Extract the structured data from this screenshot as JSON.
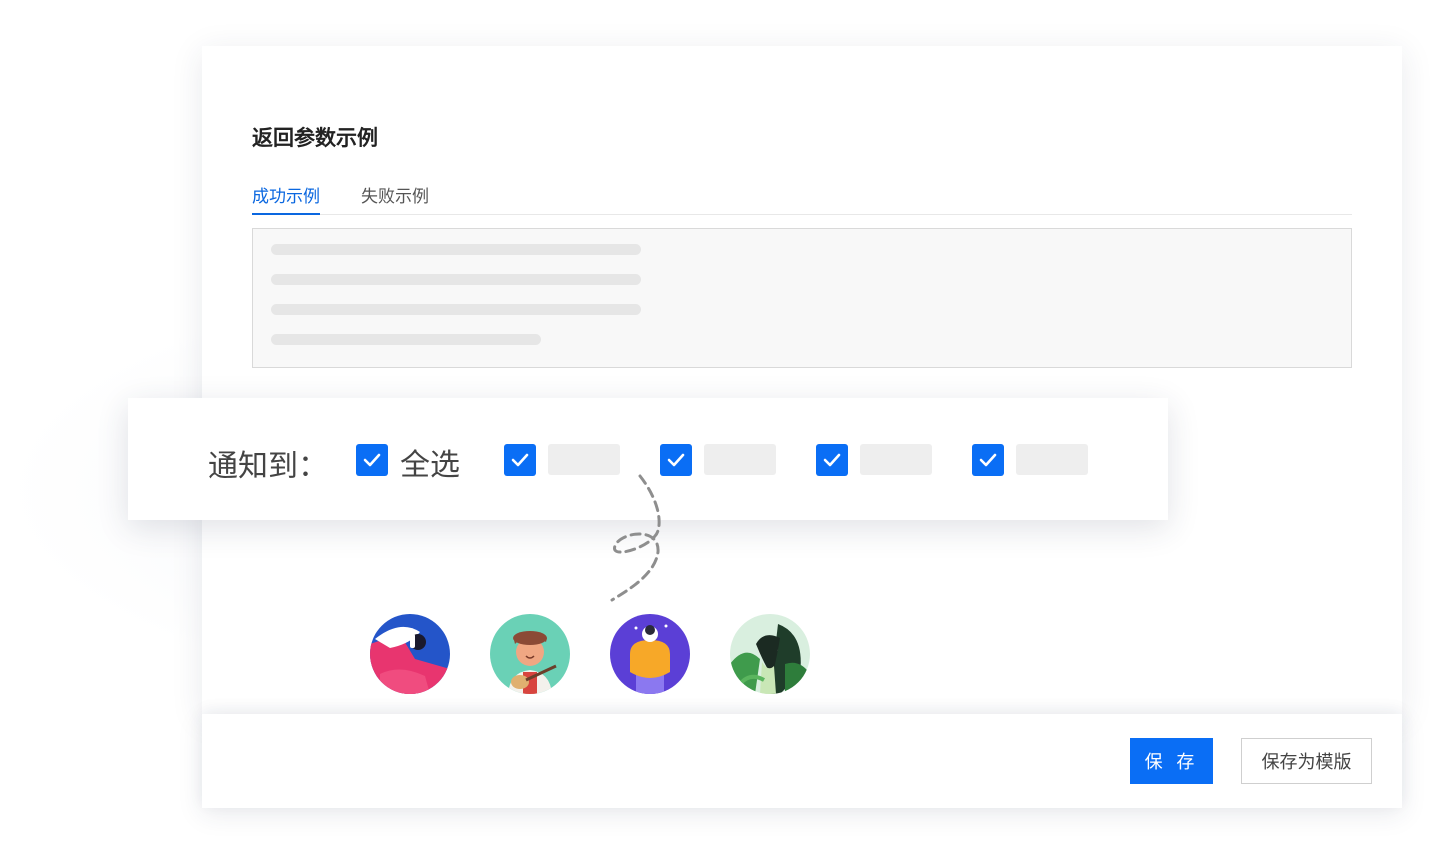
{
  "section": {
    "title": "返回参数示例"
  },
  "tabs": [
    {
      "label": "成功示例",
      "active": true
    },
    {
      "label": "失败示例",
      "active": false
    }
  ],
  "notify": {
    "label": "通知到：",
    "select_all_label": "全选",
    "select_all_checked": true,
    "recipients_checked": [
      true,
      true,
      true,
      true
    ]
  },
  "footer": {
    "save_label": "保 存",
    "save_template_label": "保存为模版"
  },
  "avatars": [
    {
      "icon": "avatar-headphones-illustration"
    },
    {
      "icon": "avatar-guitar-player-illustration"
    },
    {
      "icon": "avatar-orange-sweater-illustration"
    },
    {
      "icon": "avatar-forest-woman-illustration"
    }
  ],
  "colors": {
    "accent": "#0a6ef5",
    "tab_active": "#0a67e0"
  }
}
